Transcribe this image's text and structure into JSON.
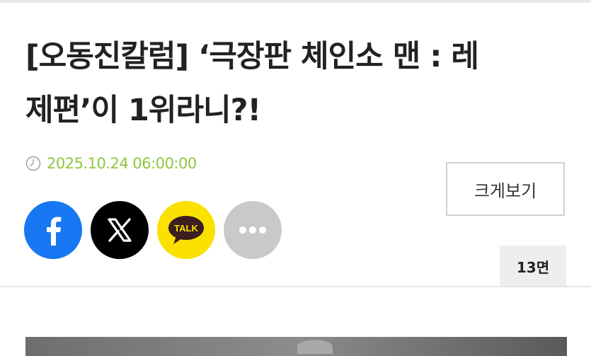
{
  "article": {
    "headline_line1": "[오동진칼럼] ‘극장판 체인소 맨 : 레",
    "headline_line2": "제편’이 1위라니?!",
    "published_at": "2025.10.24 06:00:00",
    "date_color": "#8dc63f"
  },
  "share": {
    "buttons": [
      {
        "name": "facebook",
        "icon": "facebook-icon",
        "color": "#1877f2"
      },
      {
        "name": "x",
        "icon": "x-icon",
        "color": "#000000"
      },
      {
        "name": "kakaotalk",
        "icon": "kakaotalk-icon",
        "color": "#fae100",
        "label": "TALK"
      },
      {
        "name": "more",
        "icon": "more-dots-icon",
        "color": "#c9c9c9"
      }
    ]
  },
  "controls": {
    "enlarge_label": "크게보기",
    "page_badge": "13면"
  }
}
